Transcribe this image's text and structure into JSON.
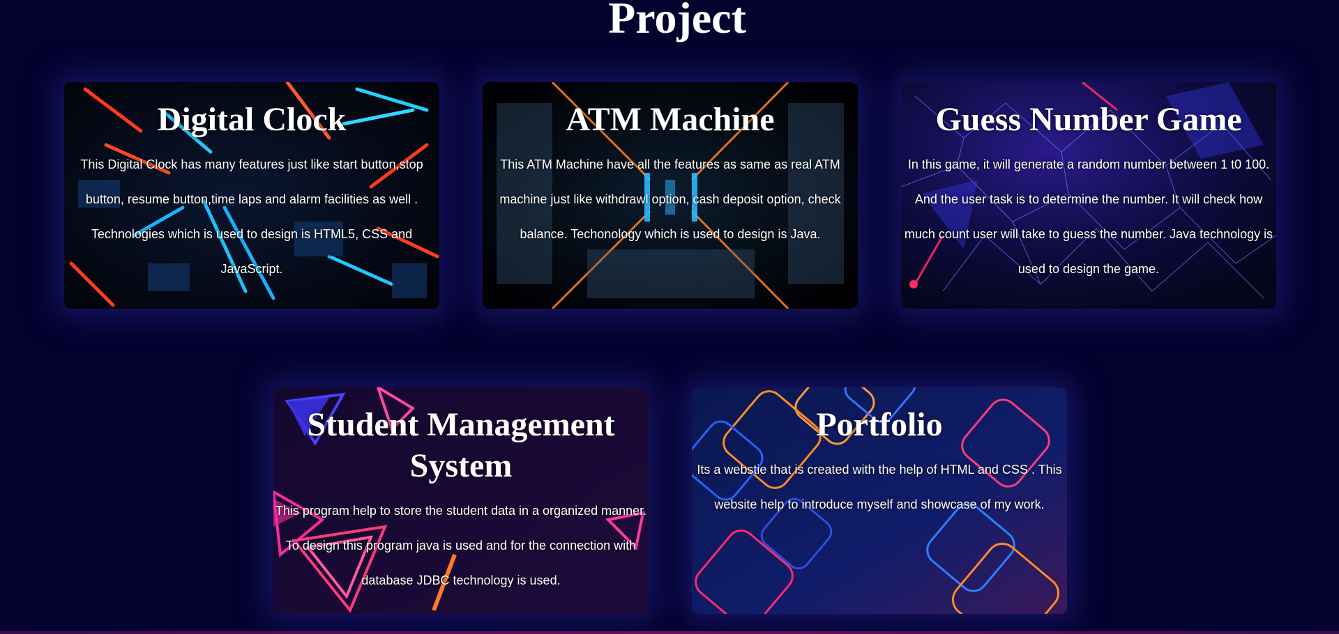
{
  "section": {
    "title": "Project"
  },
  "projects": [
    {
      "title": "Digital Clock",
      "description": "This Digital Clock has many features just like start button,stop button, resume button,time laps and alarm facilities as well . Technologies which is used to design is HTML5, CSS and JavaScript."
    },
    {
      "title": "ATM Machine",
      "description": "This ATM Machine have all the features as same as real ATM machine just like withdrawl option, cash deposit option, check balance. Techonology which is used to design is Java."
    },
    {
      "title": "Guess Number Game",
      "description": "In this game, it will generate a random number between 1 t0 100. And the user task is to determine the number. It will check how much count user will take to guess the number. Java technology is used to design the game."
    },
    {
      "title": "Student Management System",
      "description": "This program help to store the student data in a organized manner. To design this program java is used and for the connection with database JDBC technology is used."
    },
    {
      "title": "Portfolio",
      "description": "Its a webstie that is created with the help of HTML and CSS . This website help to introduce myself and showcase of my work."
    }
  ],
  "colors": {
    "page_background": "#03022e",
    "card_glow": "#1c1a6e",
    "text": "#ffffff"
  }
}
